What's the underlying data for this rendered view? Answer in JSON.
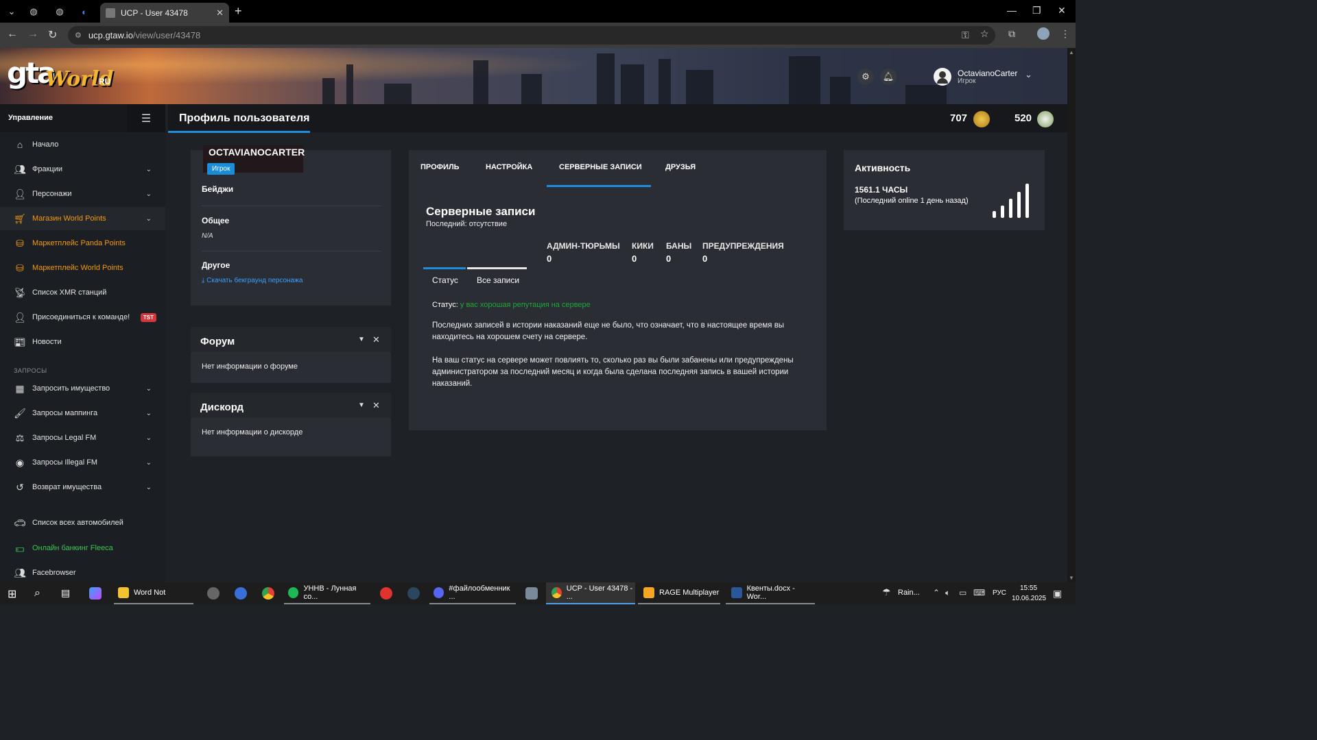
{
  "browser": {
    "tab_title": "UCP - User 43478",
    "url_host": "ucp.gtaw.io",
    "url_path": "/view/user/43478"
  },
  "banner": {
    "logo_gta": "gta",
    "logo_world": "World",
    "logo_ru": "RU",
    "user_name": "OctavianoCarter",
    "user_role": "Игрок"
  },
  "sidebar": {
    "title": "Управление",
    "section_requests": "ЗАПРОСЫ",
    "items": [
      {
        "label": "Начало",
        "icon": "home-icon"
      },
      {
        "label": "Фракции",
        "icon": "users-icon"
      },
      {
        "label": "Персонажи",
        "icon": "user-icon"
      },
      {
        "label": "Магазин World Points",
        "icon": "cart-icon"
      },
      {
        "label": "Маркетплейс Panda Points",
        "icon": "coins-icon"
      },
      {
        "label": "Маркетплейс World Points",
        "icon": "coins-icon"
      },
      {
        "label": "Список XMR станций",
        "icon": "antenna-icon"
      },
      {
        "label": "Присоединиться к команде!",
        "icon": "user-tie-icon",
        "badge": "TST"
      },
      {
        "label": "Новости",
        "icon": "newspaper-icon"
      },
      {
        "label": "Запросить имущество",
        "icon": "building-icon"
      },
      {
        "label": "Запросы маппинга",
        "icon": "brush-icon"
      },
      {
        "label": "Запросы Legal FM",
        "icon": "scale-icon"
      },
      {
        "label": "Запросы Illegal FM",
        "icon": "mask-icon"
      },
      {
        "label": "Возврат имущества",
        "icon": "undo-icon"
      },
      {
        "label": "Список всех автомобилей",
        "icon": "car-icon"
      },
      {
        "label": "Онлайн банкинг Fleeca",
        "icon": "money-icon"
      },
      {
        "label": "Facebrowser",
        "icon": "users-icon"
      }
    ]
  },
  "header": {
    "page_title": "Профиль пользователя",
    "world_points": "707",
    "panda_points": "520"
  },
  "profile": {
    "name": "OCTAVIANOCARTER",
    "role": "Игрок",
    "badges_label": "Бейджи",
    "general_label": "Общее",
    "general_value": "N/A",
    "other_label": "Другое",
    "download_link": "Скачать бекграунд персонажа"
  },
  "forum": {
    "title": "Форум",
    "body": "Нет информации о форуме"
  },
  "discord": {
    "title": "Дискорд",
    "body": "Нет информации о дискорде"
  },
  "records": {
    "tabs": [
      "ПРОФИЛЬ",
      "НАСТРОЙКА",
      "СЕРВЕРНЫЕ ЗАПИСИ",
      "ДРУЗЬЯ"
    ],
    "title": "Серверные записи",
    "last": "Последний: отсутствие",
    "stats": [
      {
        "label": "АДМИН-ТЮРЬМЫ",
        "value": "0"
      },
      {
        "label": "КИКИ",
        "value": "0"
      },
      {
        "label": "БАНЫ",
        "value": "0"
      },
      {
        "label": "ПРЕДУПРЕЖДЕНИЯ",
        "value": "0"
      }
    ],
    "subtab_status": "Статус",
    "subtab_all": "Все записи",
    "status_label": "Статус:",
    "status_value": "у вас хорошая репутация на сервере",
    "para1": "Последних записей в истории наказаний еще не было, что означает, что в настоящее время вы находитесь на хорошем счету на сервере.",
    "para2": "На ваш статус на сервере может повлиять то, сколько раз вы были забанены или предупреждены администратором за последний месяц и когда была сделана последняя запись в вашей истории наказаний."
  },
  "activity": {
    "title": "Активность",
    "hours": "1561.1 ЧАСЫ",
    "last_online": "(Последний online 1 день назад)"
  },
  "taskbar": {
    "apps": [
      {
        "label": "Word Not"
      },
      {
        "label": "УННВ - Лунная со..."
      },
      {
        "label": "#файлообменник ..."
      },
      {
        "label": "UCP - User 43478 - ..."
      },
      {
        "label": "RAGE Multiplayer"
      },
      {
        "label": "Квенты.docx - Wor..."
      }
    ],
    "weather": "Rain...",
    "lang": "РУС",
    "time": "15:55",
    "date": "10.06.2025"
  },
  "colors": {
    "accent": "#1e8fe0",
    "orange": "#f29a12",
    "green": "#3ec454",
    "badge_red": "#d3373e"
  }
}
